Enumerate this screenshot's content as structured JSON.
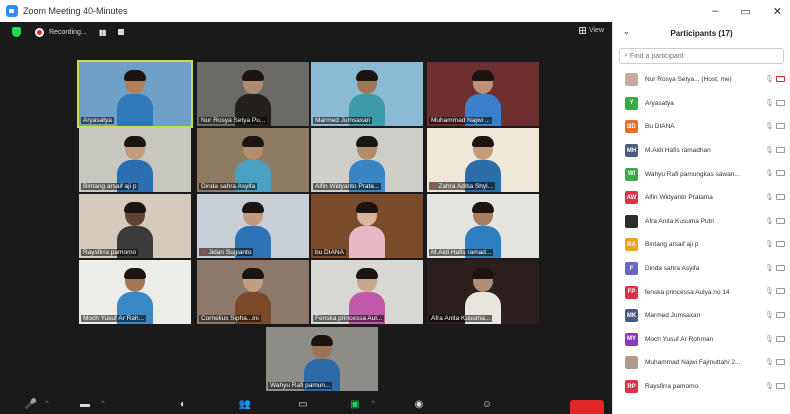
{
  "window": {
    "title": "Zoom Meeting 40-Minutes",
    "controls": [
      "–",
      "▭",
      "✕"
    ]
  },
  "meeting": {
    "recording_label": "Recording...",
    "view_label": "View",
    "tiles": [
      {
        "name": "Aryasatya",
        "bg": "#6fa0c8",
        "skin": "#b07f5c",
        "shirt": "#2f79b8",
        "active": true
      },
      {
        "name": "Nur Rosya Setya Pu...",
        "bg": "#6b6a64",
        "skin": "#b08b73",
        "shirt": "#24201c"
      },
      {
        "name": "Marmed Jumsaxan",
        "bg": "#8bbad4",
        "skin": "#9e7656",
        "shirt": "#3d9aa8"
      },
      {
        "name": "Muhammad Najwi ...",
        "bg": "#6e2f2f",
        "skin": "#c09173",
        "shirt": "#3b7ec9"
      },
      {
        "name": "Bintang arsaif aji p",
        "bg": "#c7c7c0",
        "skin": "#c29c7c",
        "shirt": "#2d6eb3"
      },
      {
        "name": "Dinda sahra Asyifa",
        "bg": "#8f7b62",
        "skin": "#b48e6d",
        "shirt": "#4aa0c2"
      },
      {
        "name": "Alfin Widyanto Prata...",
        "bg": "#cfcfca",
        "skin": "#b38c6c",
        "shirt": "#3a86c4"
      },
      {
        "name": "Zahra Aditia Shyl...",
        "bg": "#efe8d8",
        "skin": "#c49b7b",
        "shirt": "#2c6fa8",
        "muted": true
      },
      {
        "name": "Raysfirra pamomo",
        "bg": "#d5cbbc",
        "skin": "#5f4331",
        "shirt": "#3b3b3b"
      },
      {
        "name": "Jidan Sugianto",
        "bg": "#c9cfd6",
        "skin": "#c29b7e",
        "shirt": "#2d73b6",
        "muted": true
      },
      {
        "name": "bu DIANA",
        "bg": "#7a4c2b",
        "skin": "#dab49a",
        "shirt": "#e6b9c4"
      },
      {
        "name": "M.Aldi Hafis ramad...",
        "bg": "#e4e4e0",
        "skin": "#a97e5e",
        "shirt": "#2f7fc0"
      },
      {
        "name": "Moch Yusuf Ar Rah...",
        "bg": "#ecece8",
        "skin": "#a17756",
        "shirt": "#3a87c7"
      },
      {
        "name": "Cornelius Sipha...ini",
        "bg": "#8e7a6a",
        "skin": "#c29d82",
        "shirt": "#7a4a2a"
      },
      {
        "name": "Fenska princessa Aul...",
        "bg": "#d8d8d4",
        "skin": "#c8a58c",
        "shirt": "#c15aa8"
      },
      {
        "name": "Afra Anita Kusuma...",
        "bg": "#2a1f1c",
        "skin": "#b08d78",
        "shirt": "#e9e5df"
      },
      {
        "name": "Wahyu Rafi pamun...",
        "bg": "#8e8c86",
        "skin": "#9c7556",
        "shirt": "#2d6aa8"
      }
    ]
  },
  "toolbar": {
    "end_color": "#e02828"
  },
  "participants": {
    "title": "Participants (17)",
    "search_placeholder": "Find a participant",
    "items": [
      {
        "name": "Nur Rosya Setya... (Host, me)",
        "initials": "",
        "color": "#c9a9a0",
        "cam_red": true
      },
      {
        "name": "Aryasatya",
        "initials": "Y",
        "color": "#3aa845"
      },
      {
        "name": "Bu DIANA",
        "initials": "BD",
        "color": "#e8702a"
      },
      {
        "name": "M.Aldi Hafis ramadhan",
        "initials": "MH",
        "color": "#4a5d7e"
      },
      {
        "name": "Wahyu Rafi pamungkas sawan...",
        "initials": "WI",
        "color": "#3aa845"
      },
      {
        "name": "Alfin Widyanto Pratama",
        "initials": "AW",
        "color": "#d8334a"
      },
      {
        "name": "Afra Anita Kusuma Putri",
        "initials": "",
        "color": "#2b2b2b"
      },
      {
        "name": "Bintang arsaif aji p",
        "initials": "BA",
        "color": "#f0a020"
      },
      {
        "name": "Dinda sahra Asyifa",
        "initials": "F",
        "color": "#6b63c9"
      },
      {
        "name": "fenska princessa Aulya no 14",
        "initials": "FP",
        "color": "#d8334a"
      },
      {
        "name": "Marmed Jumsaxan",
        "initials": "MK",
        "color": "#4a5d7e"
      },
      {
        "name": "Moch Yusuf Ar Rohman",
        "initials": "MY",
        "color": "#8a3ab8"
      },
      {
        "name": "Muhammad Najwi Fajmuttah/ 2...",
        "initials": "",
        "color": "#b09b8a"
      },
      {
        "name": "Raysfirra pamomo",
        "initials": "RP",
        "color": "#d8334a"
      }
    ]
  }
}
